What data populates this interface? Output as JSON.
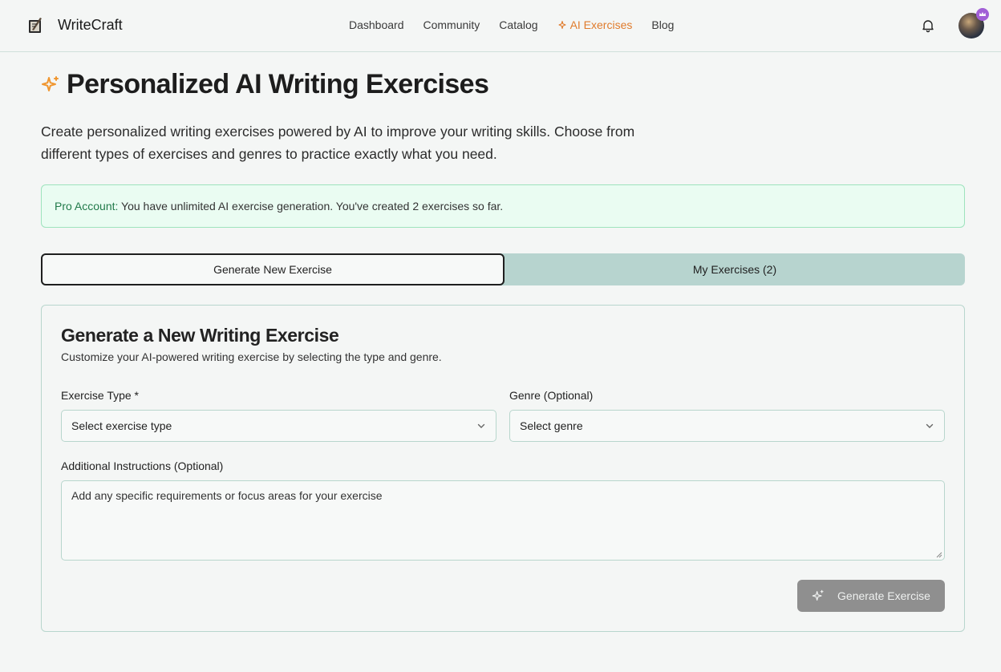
{
  "brand": {
    "name": "WriteCraft",
    "logo_icon": "quill-book-icon"
  },
  "nav": {
    "items": [
      {
        "label": "Dashboard"
      },
      {
        "label": "Community"
      },
      {
        "label": "Catalog"
      },
      {
        "label": "AI Exercises",
        "active": true,
        "icon": "sparkle-icon"
      },
      {
        "label": "Blog"
      }
    ],
    "accent_color": "#e07b2c"
  },
  "header": {
    "bell_icon": "bell-icon",
    "avatar_badge_icon": "crown-icon",
    "avatar_badge_color": "#a15fd6"
  },
  "page": {
    "title": "Personalized AI Writing Exercises",
    "intro": "Create personalized writing exercises powered by AI to improve your writing skills. Choose from different types of exercises and genres to practice exactly what you need."
  },
  "pro_banner": {
    "label": "Pro Account:",
    "text": " You have unlimited AI exercise generation. You've created 2 exercises so far."
  },
  "tabs": [
    {
      "label": "Generate New Exercise",
      "active": true
    },
    {
      "label": "My Exercises (2)",
      "active": false
    }
  ],
  "form": {
    "title": "Generate a New Writing Exercise",
    "subtitle": "Customize your AI-powered writing exercise by selecting the type and genre.",
    "exercise_type": {
      "label": "Exercise Type *",
      "placeholder": "Select exercise type"
    },
    "genre": {
      "label": "Genre (Optional)",
      "placeholder": "Select genre"
    },
    "instructions": {
      "label": "Additional Instructions (Optional)",
      "placeholder": "Add any specific requirements or focus areas for your exercise"
    },
    "submit_label": "Generate Exercise"
  }
}
